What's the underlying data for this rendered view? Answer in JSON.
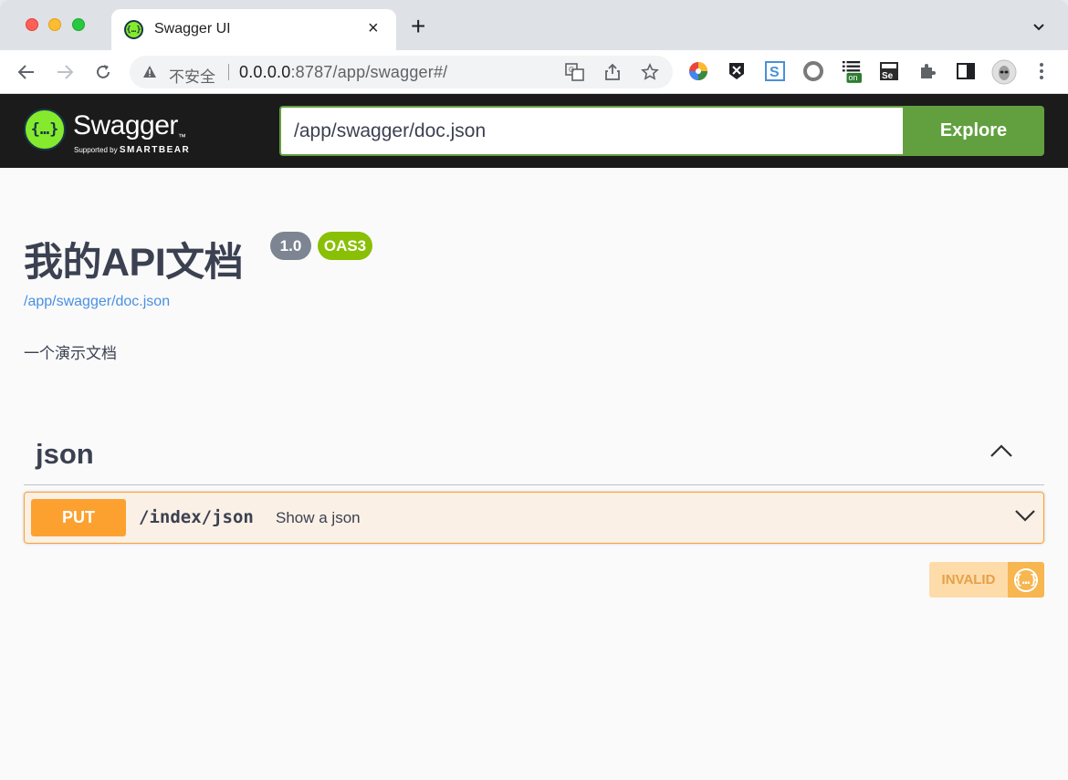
{
  "browser": {
    "tab_title": "Swagger UI",
    "insecure_label": "不安全",
    "url_host": "0.0.0.0",
    "url_rest": ":8787/app/swagger#/",
    "extension_badge": "on"
  },
  "topbar": {
    "logo_glyph": "{…}",
    "brand_name": "Swagger",
    "trademark": "™",
    "supported_by": "Supported by",
    "sponsor": "SMARTBEAR",
    "spec_url_value": "/app/swagger/doc.json",
    "explore_label": "Explore"
  },
  "info": {
    "title": "我的API文档",
    "version": "1.0",
    "oas": "OAS3",
    "spec_link": "/app/swagger/doc.json",
    "description": "一个演示文档"
  },
  "tags": [
    {
      "name": "json",
      "operations": [
        {
          "method": "PUT",
          "path": "/index/json",
          "summary": "Show a json",
          "color": "#fca130"
        }
      ]
    }
  ],
  "validator": {
    "label": "INVALID",
    "icon_glyph": "{…}"
  },
  "colors": {
    "brand_green": "#85ea2d",
    "explore_green": "#62a03f",
    "put_orange": "#fca130",
    "link_blue": "#4990e2"
  }
}
